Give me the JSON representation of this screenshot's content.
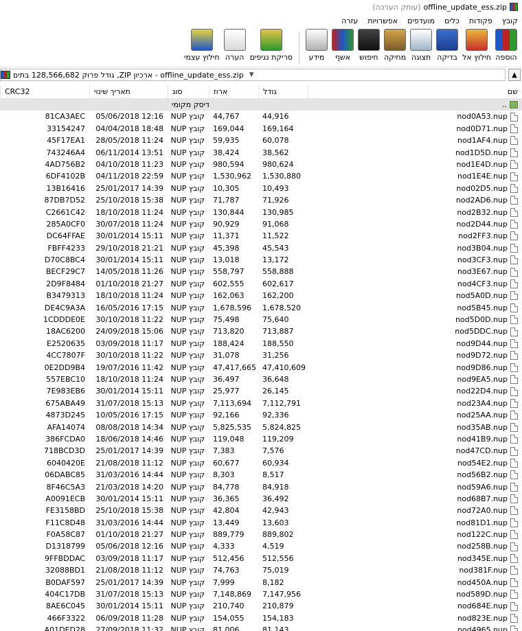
{
  "window": {
    "title": "offline_update_ess.zip",
    "subtitle": "(עותק הערכה)"
  },
  "menu": [
    "קובץ",
    "פקודות",
    "כלים",
    "מועדפים",
    "אפשרויות",
    "עזרה"
  ],
  "toolbar": [
    {
      "label": "הוספה",
      "icon": "add-archive-icon"
    },
    {
      "label": "חילוץ אל",
      "icon": "extract-to-icon"
    },
    {
      "label": "בדיקה",
      "icon": "test-icon"
    },
    {
      "label": "תצוגה",
      "icon": "view-icon"
    },
    {
      "label": "מחיקה",
      "icon": "delete-icon"
    },
    {
      "label": "חיפוש",
      "icon": "find-icon"
    },
    {
      "label": "אשף",
      "icon": "wizard-icon"
    },
    {
      "label": "מידע",
      "icon": "info-icon"
    },
    {
      "label": "סריקת נגיפים",
      "icon": "virus-scan-icon"
    },
    {
      "label": "הערה",
      "icon": "comment-icon"
    },
    {
      "label": "חילוץ עצמי",
      "icon": "sfx-icon"
    }
  ],
  "address": {
    "text": "offline_update_ess.zip - ארכיון ZIP, גודל פרוק 128,566,682 בתים"
  },
  "columns": {
    "name": "שם",
    "size": "גודל",
    "packed": "ארוז",
    "type": "סוג",
    "modified": "תאריך שינוי",
    "crc": "CRC32"
  },
  "updir": {
    "name": "..",
    "type": "דיסק מקומי"
  },
  "files": [
    [
      "nod0A53.nup",
      "44,916",
      "44,767",
      "קובץ NUP",
      "05/06/2018 12:16",
      "81CA3AEC"
    ],
    [
      "nod0D71.nup",
      "169,164",
      "169,044",
      "קובץ NUP",
      "04/04/2018 18:48",
      "33154247"
    ],
    [
      "nod1AF4.nup",
      "60,078",
      "59,935",
      "קובץ NUP",
      "28/05/2018 11:24",
      "45F17EA1"
    ],
    [
      "nod1D5D.nup",
      "38,562",
      "38,424",
      "קובץ NUP",
      "06/11/2014 13:51",
      "743246A4"
    ],
    [
      "nod1E4D.nup",
      "980,624",
      "980,594",
      "קובץ NUP",
      "04/10/2018 11:23",
      "4AD756B2"
    ],
    [
      "nod1E4E.nup",
      "1,530,880",
      "1,530,962",
      "קובץ NUP",
      "04/11/2018 22:59",
      "6DF4102B"
    ],
    [
      "nod02D5.nup",
      "10,493",
      "10,305",
      "קובץ NUP",
      "25/01/2017 14:39",
      "13B16416"
    ],
    [
      "nod2AD6.nup",
      "71,926",
      "71,787",
      "קובץ NUP",
      "25/10/2018 15:38",
      "87DB7D52"
    ],
    [
      "nod2B32.nup",
      "130,985",
      "130,844",
      "קובץ NUP",
      "18/10/2018 11:24",
      "C2661C42"
    ],
    [
      "nod2D44.nup",
      "91,068",
      "90,929",
      "קובץ NUP",
      "30/07/2018 11:24",
      "285A0CF0"
    ],
    [
      "nod2FF3.nup",
      "11,522",
      "11,371",
      "קובץ NUP",
      "30/01/2014 15:11",
      "DC64FFAE"
    ],
    [
      "nod3B04.nup",
      "45,543",
      "45,398",
      "קובץ NUP",
      "29/10/2018 21:21",
      "FBFF4233"
    ],
    [
      "nod3CF3.nup",
      "13,172",
      "13,018",
      "קובץ NUP",
      "30/01/2014 15:11",
      "D70C8BC4"
    ],
    [
      "nod3E67.nup",
      "558,888",
      "558,797",
      "קובץ NUP",
      "14/05/2018 11:26",
      "BECF29C7"
    ],
    [
      "nod4CF3.nup",
      "602,617",
      "602,555",
      "קובץ NUP",
      "01/10/2018 21:27",
      "2D9F8484"
    ],
    [
      "nod5A0D.nup",
      "162,200",
      "162,063",
      "קובץ NUP",
      "18/10/2018 11:24",
      "B3479313"
    ],
    [
      "nod5B45.nup",
      "1,678,520",
      "1,678,596",
      "קובץ NUP",
      "16/05/2016 17:15",
      "DE4C9A3A"
    ],
    [
      "nod5D0D.nup",
      "75,640",
      "75,498",
      "קובץ NUP",
      "30/10/2018 11:22",
      "1CDDDE0E"
    ],
    [
      "nod5DDC.nup",
      "713,887",
      "713,820",
      "קובץ NUP",
      "24/09/2018 15:06",
      "18AC6200"
    ],
    [
      "nod9D44.nup",
      "188,550",
      "188,424",
      "קובץ NUP",
      "03/09/2018 11:17",
      "E2520635"
    ],
    [
      "nod9D72.nup",
      "31,256",
      "31,078",
      "קובץ NUP",
      "30/10/2018 11:22",
      "4CC7807F"
    ],
    [
      "nod9D86.nup",
      "47,410,609",
      "47,417,665",
      "קובץ NUP",
      "19/07/2016 11:42",
      "0E2DD9B4"
    ],
    [
      "nod9EA5.nup",
      "36,648",
      "36,497",
      "קובץ NUP",
      "18/10/2018 11:24",
      "557EBC10"
    ],
    [
      "nod22D4.nup",
      "26,145",
      "25,977",
      "קובץ NUP",
      "30/01/2014 15:11",
      "7E983EB6"
    ],
    [
      "nod23A4.nup",
      "7,112,791",
      "7,113,694",
      "קובץ NUP",
      "31/07/2018 15:13",
      "675ABA49"
    ],
    [
      "nod25AA.nup",
      "92,336",
      "92,166",
      "קובץ NUP",
      "10/05/2016 17:15",
      "4873D245"
    ],
    [
      "nod35AB.nup",
      "5,824,825",
      "5,825,535",
      "קובץ NUP",
      "08/08/2018 14:34",
      "AFA14074"
    ],
    [
      "nod41B9.nup",
      "119,209",
      "119,048",
      "קובץ NUP",
      "18/06/2018 14:46",
      "386FCDA0"
    ],
    [
      "nod47CD.nup",
      "7,576",
      "7,383",
      "קובץ NUP",
      "25/01/2017 14:39",
      "718BCD3D"
    ],
    [
      "nod54E2.nup",
      "60,934",
      "60,677",
      "קובץ NUP",
      "21/08/2018 11:12",
      "6040420E"
    ],
    [
      "nod56B2.nup",
      "8,517",
      "8,303",
      "קובץ NUP",
      "31/03/2016 14:44",
      "06DABC85"
    ],
    [
      "nod59A6.nup",
      "84,918",
      "84,778",
      "קובץ NUP",
      "21/03/2018 14:20",
      "8F46C5A3"
    ],
    [
      "nod68B7.nup",
      "36,492",
      "36,365",
      "קובץ NUP",
      "30/01/2014 15:11",
      "A0091ECB"
    ],
    [
      "nod72A0.nup",
      "42,943",
      "42,804",
      "קובץ NUP",
      "25/10/2018 15:38",
      "FE3158BD"
    ],
    [
      "nod81D1.nup",
      "13,603",
      "13,449",
      "קובץ NUP",
      "31/03/2016 14:44",
      "F11C8D48"
    ],
    [
      "nod122C.nup",
      "889,802",
      "889,779",
      "קובץ NUP",
      "01/10/2018 21:27",
      "F0A58C87"
    ],
    [
      "nod258B.nup",
      "4,519",
      "4,333",
      "קובץ NUP",
      "05/06/2018 12:16",
      "D1318799"
    ],
    [
      "nod345E.nup",
      "512,556",
      "512,456",
      "קובץ NUP",
      "03/09/2018 11:17",
      "9FFBDDAC"
    ],
    [
      "nod381F.nup",
      "75,019",
      "74,763",
      "קובץ NUP",
      "21/08/2018 11:12",
      "32088BD1"
    ],
    [
      "nod450A.nup",
      "8,182",
      "7,999",
      "קובץ NUP",
      "25/01/2017 14:39",
      "B0DAF597"
    ],
    [
      "nod589D.nup",
      "7,147,956",
      "7,148,869",
      "קובץ NUP",
      "31/07/2018 15:13",
      "404C17DB"
    ],
    [
      "nod684E.nup",
      "210,879",
      "210,740",
      "קובץ NUP",
      "30/01/2014 15:11",
      "8AE6C045"
    ],
    [
      "nod823E.nup",
      "154,183",
      "154,055",
      "קובץ NUP",
      "06/09/2018 11:28",
      "466F3322"
    ],
    [
      "nod4965.nup",
      "81,143",
      "81,006",
      "קובץ NUP",
      "27/09/2018 11:32",
      "A01DED28"
    ]
  ]
}
